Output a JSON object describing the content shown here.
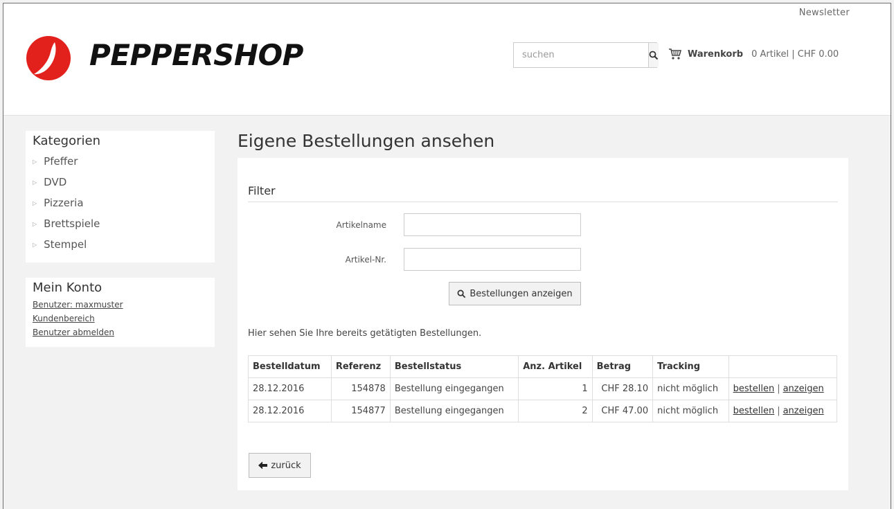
{
  "header": {
    "newsletter": "Newsletter",
    "logo_text": "PEPPERSHOP",
    "search_placeholder": "suchen",
    "cart_label": "Warenkorb",
    "cart_info": "0 Artikel | CHF 0.00"
  },
  "sidebar": {
    "categories_title": "Kategorien",
    "categories": [
      "Pfeffer",
      "DVD",
      "Pizzeria",
      "Brettspiele",
      "Stempel"
    ],
    "account_title": "Mein Konto",
    "account_links": [
      "Benutzer: maxmuster",
      "Kundenbereich",
      "Benutzer abmelden"
    ]
  },
  "main": {
    "title": "Eigene Bestellungen ansehen",
    "filter_title": "Filter",
    "field_article_name": "Artikelname",
    "field_article_no": "Artikel-Nr.",
    "show_orders_button": "Bestellungen anzeigen",
    "info_text": "Hier sehen Sie Ihre bereits getätigten Bestellungen.",
    "table": {
      "headers": [
        "Bestelldatum",
        "Referenz",
        "Bestellstatus",
        "Anz. Artikel",
        "Betrag",
        "Tracking",
        ""
      ],
      "rows": [
        {
          "date": "28.12.2016",
          "ref": "154878",
          "status": "Bestellung eingegangen",
          "count": "1",
          "amount": "CHF 28.10",
          "tracking": "nicht möglich",
          "order": "bestellen",
          "sep": "|",
          "show": "anzeigen"
        },
        {
          "date": "28.12.2016",
          "ref": "154877",
          "status": "Bestellung eingegangen",
          "count": "2",
          "amount": "CHF 47.00",
          "tracking": "nicht möglich",
          "order": "bestellen",
          "sep": "|",
          "show": "anzeigen"
        }
      ]
    },
    "back_button": "zurück"
  },
  "colors": {
    "logo_red": "#e3211c",
    "background": "#f2f2f2",
    "panel": "#ffffff"
  }
}
